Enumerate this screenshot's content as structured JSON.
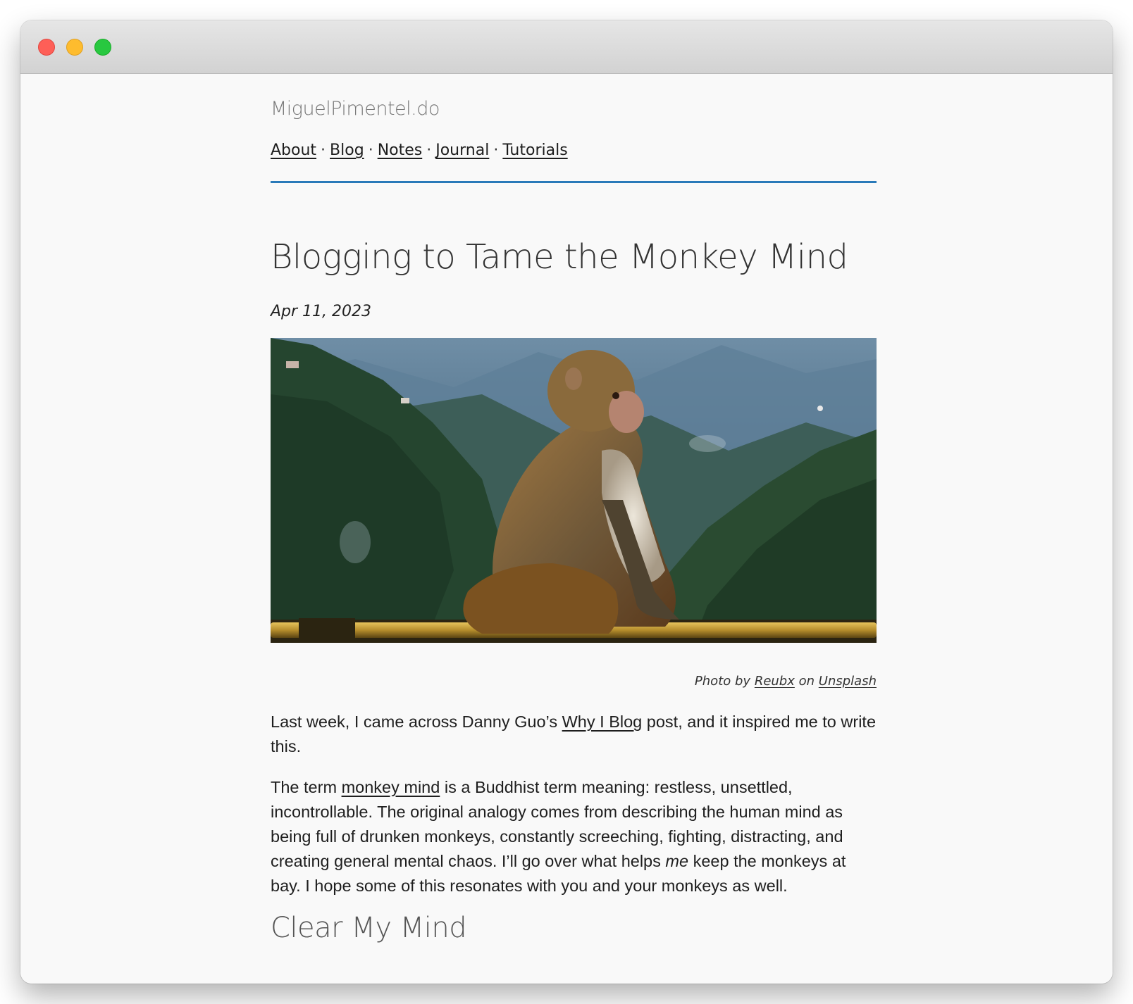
{
  "site": {
    "title": "MiguelPimentel.do"
  },
  "nav": {
    "items": [
      {
        "label": "About"
      },
      {
        "label": "Blog"
      },
      {
        "label": "Notes"
      },
      {
        "label": "Journal"
      },
      {
        "label": "Tutorials"
      }
    ],
    "separator": "·",
    "accent_color": "#2a7ab9"
  },
  "post": {
    "title": "Blogging to Tame the Monkey Mind",
    "date": "Apr 11, 2023",
    "hero_image": {
      "icon": "monkey-photo"
    },
    "caption": {
      "prefix": "Photo by",
      "author": "Reubx",
      "middle": "on",
      "source": "Unsplash"
    },
    "paragraph1": {
      "before": "Last week, I came across Danny Guo’s ",
      "link": "Why I Blog",
      "after": " post, and it inspired me to write this."
    },
    "paragraph2": {
      "before": "The term ",
      "link": "monkey mind",
      "middle": " is a Buddhist term meaning: restless, unsettled, incontrollable. The original analogy comes from describing the human mind as being full of drunken monkeys, constantly screeching, fighting, distracting, and creating general mental chaos. I’ll go over what helps ",
      "emphasis": "me",
      "after": " keep the monkeys at bay. I hope some of this resonates with you and your monkeys as well."
    },
    "section_heading": "Clear My Mind"
  }
}
